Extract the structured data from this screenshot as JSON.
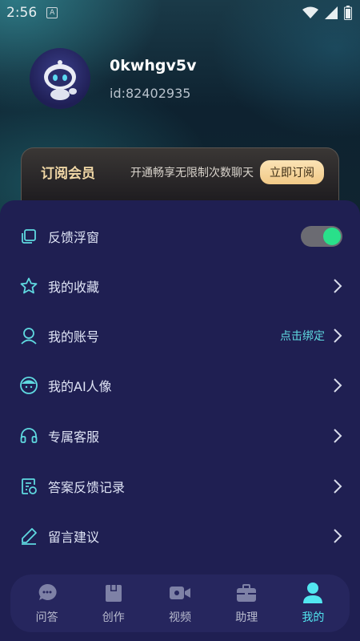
{
  "status_bar": {
    "time": "2:56",
    "notification_icon": "A"
  },
  "profile": {
    "username": "0kwhgv5v",
    "user_id": "id:82402935"
  },
  "vip": {
    "title": "订阅会员",
    "description": "开通畅享无限制次数聊天",
    "button": "立即订阅"
  },
  "menu": [
    {
      "label": "反馈浮窗",
      "icon": "window-icon",
      "toggle": true
    },
    {
      "label": "我的收藏",
      "icon": "star-icon"
    },
    {
      "label": "我的账号",
      "icon": "user-icon",
      "extra": "点击绑定"
    },
    {
      "label": "我的AI人像",
      "icon": "ai-face-icon"
    },
    {
      "label": "专属客服",
      "icon": "headset-icon"
    },
    {
      "label": "答案反馈记录",
      "icon": "record-icon"
    },
    {
      "label": "留言建议",
      "icon": "pen-icon"
    }
  ],
  "tabs": [
    {
      "label": "问答",
      "icon": "chat-icon"
    },
    {
      "label": "创作",
      "icon": "box-icon"
    },
    {
      "label": "视频",
      "icon": "video-icon"
    },
    {
      "label": "助理",
      "icon": "briefcase-icon"
    },
    {
      "label": "我的",
      "icon": "person-icon",
      "active": true
    }
  ],
  "colors": {
    "accent": "#52e6f0",
    "toggle_on": "#29e08a",
    "panel": "#1f1f52"
  }
}
